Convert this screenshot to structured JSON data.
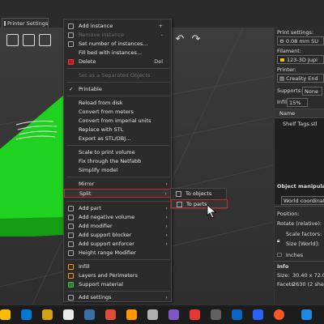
{
  "tabs": {
    "printer_settings": "Printer Settings"
  },
  "panel": {
    "print_settings_label": "Print settings:",
    "print_settings_value": "0.08 mm SU",
    "filament_label": "Filament:",
    "filament_value": "123-3D Jupi",
    "filament_color": "#f1c40f",
    "printer_label": "Printer:",
    "printer_value": "Creality End",
    "supports_label": "Supports:",
    "supports_value": "None",
    "infill_label": "Infill:",
    "infill_value": "15%",
    "name_header": "Name",
    "object_name": "Shelf Tags.stl",
    "object_manip_label": "Object manipulati",
    "world_coords": "World coordinate",
    "position_label": "Position:",
    "rotate_label": "Rotate (relative):",
    "scale_label": "Scale factors:",
    "size_label": "Size [World]:",
    "inches_label": "Inches",
    "info_label": "Info",
    "size_value_label": "Size:",
    "size_value": "30.40 x 72.0",
    "facets_label": "Facets:",
    "facets_value": "2630 (2 she"
  },
  "menu": {
    "add_instance": "Add instance",
    "add_instance_sc": "+",
    "remove_instance": "Remove instance",
    "remove_instance_sc": "-",
    "set_instances": "Set number of instances...",
    "fill_bed": "Fill bed with instances...",
    "delete": "Delete",
    "delete_sc": "Del",
    "set_separated": "Set as a Separated Objects",
    "printable": "Printable",
    "reload": "Reload from disk",
    "convert_meters": "Convert from meters",
    "convert_imperial": "Convert from imperial units",
    "replace_stl": "Replace with STL",
    "export_stl": "Export as STL/OBJ...",
    "scale_volume": "Scale to print volume",
    "fix_netfabb": "Fix through the Netfabb",
    "simplify": "Simplify model",
    "mirror": "Mirror",
    "split": "Split",
    "add_part": "Add part",
    "add_negative": "Add negative volume",
    "add_modifier": "Add modifier",
    "add_support_blocker": "Add support blocker",
    "add_support_enforcer": "Add support enforcer",
    "height_range": "Height range Modifier",
    "infill": "Infill",
    "layers_perimeters": "Layers and Perimeters",
    "support_material": "Support material",
    "add_settings": "Add settings"
  },
  "submenu": {
    "to_objects": "To objects",
    "to_parts": "To parts"
  },
  "colors": {
    "model_green": "#1fd21f",
    "highlight_red": "#c62828"
  }
}
